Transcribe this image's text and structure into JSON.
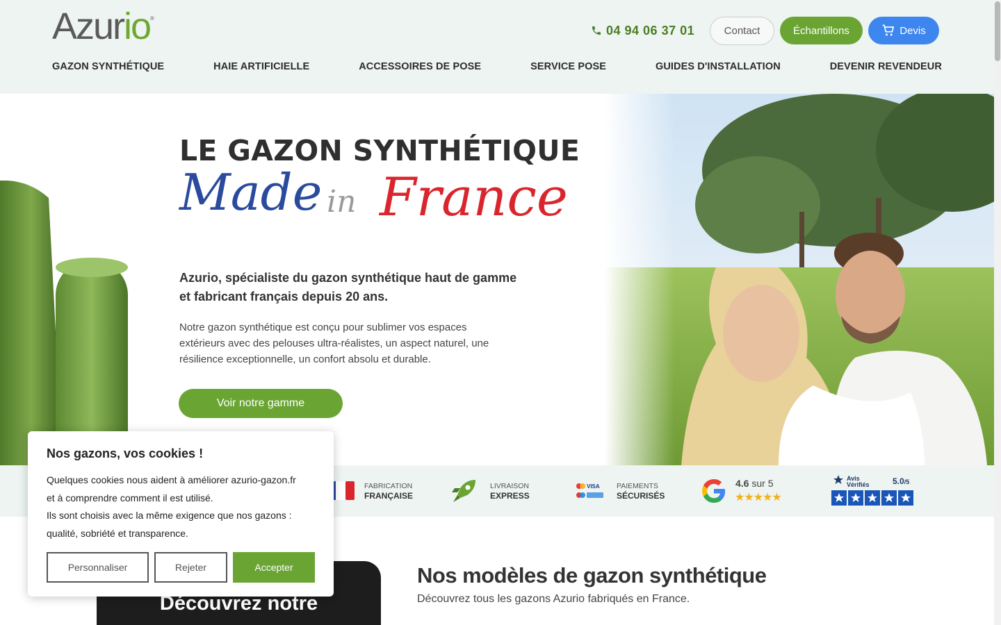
{
  "brand": {
    "name_part1": "Azur",
    "name_part2": "io",
    "reg": "®"
  },
  "header": {
    "phone": "04 94 06 37 01",
    "contact_label": "Contact",
    "echantillons_label": "Échantillons",
    "devis_label": "Devis"
  },
  "nav": {
    "items": [
      {
        "label": "GAZON SYNTHÉTIQUE"
      },
      {
        "label": "HAIE ARTIFICIELLE"
      },
      {
        "label": "ACCESSOIRES DE POSE"
      },
      {
        "label": "SERVICE POSE"
      },
      {
        "label": "GUIDES D'INSTALLATION"
      },
      {
        "label": "DEVENIR REVENDEUR"
      }
    ]
  },
  "hero": {
    "title": "LE GAZON SYNTHÉTIQUE",
    "script_made": "Made",
    "script_in": "in",
    "script_france": "France",
    "lead": "Azurio, spécialiste du gazon synthétique haut de gamme et fabricant français depuis 20 ans.",
    "description": "Notre gazon synthétique est conçu pour sublimer vos espaces extérieurs avec des pelouses ultra-réalistes, un aspect naturel, une résilience exceptionnelle, un confort absolu et durable.",
    "cta_label": "Voir notre gamme"
  },
  "trust": {
    "fabrication_top": "FABRICATION",
    "fabrication_bottom": "FRANÇAISE",
    "livraison_top": "LIVRAISON",
    "livraison_bottom": "EXPRESS",
    "paiements_top": "PAIEMENTS",
    "paiements_bottom": "SÉCURISÉS",
    "google_score": "4.6",
    "google_suffix": "sur 5",
    "google_rating": 4.6,
    "avis_title": "Avis Vérifiés",
    "avis_score": "5.0",
    "avis_suffix": "/5",
    "avis_rating": 5.0
  },
  "models": {
    "title": "Nos modèles de gazon synthétique",
    "subtitle": "Découvrez tous les gazons Azurio fabriqués en France.",
    "card_text": "Découvrez notre"
  },
  "cookie": {
    "title": "Nos gazons, vos cookies !",
    "line1": "Quelques cookies nous aident à améliorer azurio-gazon.fr",
    "line2": "et à comprendre comment il est utilisé.",
    "line3": "Ils sont choisis avec la même exigence que nos gazons :",
    "line4": "qualité, sobriété et transparence.",
    "personnaliser": "Personnaliser",
    "rejeter": "Rejeter",
    "accepter": "Accepter"
  },
  "colors": {
    "green": "#6aa534",
    "blue": "#3d86f0",
    "header_bg": "#eef4f1",
    "script_blue": "#2a4a9e",
    "script_red": "#d9262d"
  }
}
